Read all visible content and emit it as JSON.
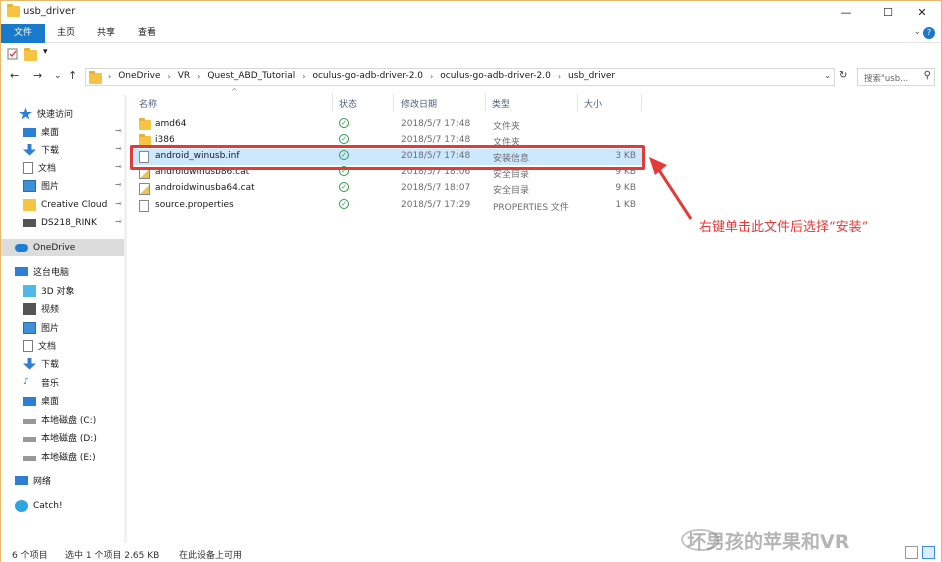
{
  "window": {
    "title": "usb_driver",
    "minimize": "—",
    "maximize": "☐",
    "close": "✕"
  },
  "ribbon": {
    "tabs": [
      "文件",
      "主页",
      "共享",
      "查看"
    ],
    "expand": "⌄",
    "help": "?"
  },
  "quick_access": {
    "dropdown": "▾"
  },
  "nav": {
    "back": "←",
    "forward": "→",
    "recent": "⌄",
    "up": "↑",
    "breadcrumbs": [
      "OneDrive",
      "VR",
      "Quest_ABD_Tutorial",
      "oculus-go-adb-driver-2.0",
      "oculus-go-adb-driver-2.0",
      "usb_driver"
    ],
    "dropdown": "⌄",
    "refresh": "↻",
    "search_placeholder": "搜索\"usb...",
    "search_icon": "⚲"
  },
  "sidebar": {
    "items": [
      {
        "label": "快速访问",
        "icon": "star-icon",
        "pinned": false
      },
      {
        "label": "桌面",
        "icon": "desktop-icon",
        "pinned": true
      },
      {
        "label": "下载",
        "icon": "download-icon",
        "pinned": true
      },
      {
        "label": "文档",
        "icon": "document-icon",
        "pinned": true
      },
      {
        "label": "图片",
        "icon": "picture-icon",
        "pinned": true
      },
      {
        "label": "Creative Cloud",
        "icon": "folder-icon",
        "pinned": true
      },
      {
        "label": "DS218_RINK",
        "icon": "network-drive-icon",
        "pinned": true
      },
      {
        "label": "OneDrive",
        "icon": "cloud-icon",
        "pinned": false
      },
      {
        "label": "这台电脑",
        "icon": "computer-icon",
        "pinned": false
      },
      {
        "label": "3D 对象",
        "icon": "cube-icon",
        "pinned": false
      },
      {
        "label": "视频",
        "icon": "video-icon",
        "pinned": false
      },
      {
        "label": "图片",
        "icon": "picture-icon",
        "pinned": false
      },
      {
        "label": "文档",
        "icon": "document-icon",
        "pinned": false
      },
      {
        "label": "下载",
        "icon": "download-icon",
        "pinned": false
      },
      {
        "label": "音乐",
        "icon": "music-icon",
        "pinned": false
      },
      {
        "label": "桌面",
        "icon": "desktop-icon",
        "pinned": false
      },
      {
        "label": "本地磁盘 (C:)",
        "icon": "drive-icon",
        "pinned": false
      },
      {
        "label": "本地磁盘 (D:)",
        "icon": "drive-icon",
        "pinned": false
      },
      {
        "label": "本地磁盘 (E:)",
        "icon": "drive-icon",
        "pinned": false
      },
      {
        "label": "网络",
        "icon": "network-icon",
        "pinned": false
      },
      {
        "label": "Catch!",
        "icon": "catch-icon",
        "pinned": false
      }
    ],
    "pin_glyph": "📌"
  },
  "columns": {
    "name": "名称",
    "status": "状态",
    "modified": "修改日期",
    "type": "类型",
    "size": "大小",
    "sort_glyph": "^"
  },
  "files": [
    {
      "name": "amd64",
      "date": "2018/5/7 17:48",
      "type": "文件夹",
      "size": "",
      "icon": "folder-icon",
      "selected": false
    },
    {
      "name": "i386",
      "date": "2018/5/7 17:48",
      "type": "文件夹",
      "size": "",
      "icon": "folder-icon",
      "selected": false
    },
    {
      "name": "android_winusb.inf",
      "date": "2018/5/7 17:48",
      "type": "安装信息",
      "size": "3 KB",
      "icon": "inf-file-icon",
      "selected": true
    },
    {
      "name": "androidwinusb86.cat",
      "date": "2018/5/7 18:06",
      "type": "安全目录",
      "size": "9 KB",
      "icon": "catalog-file-icon",
      "selected": false
    },
    {
      "name": "androidwinusba64.cat",
      "date": "2018/5/7 18:07",
      "type": "安全目录",
      "size": "9 KB",
      "icon": "catalog-file-icon",
      "selected": false
    },
    {
      "name": "source.properties",
      "date": "2018/5/7 17:29",
      "type": "PROPERTIES 文件",
      "size": "1 KB",
      "icon": "file-icon",
      "selected": false
    }
  ],
  "status_check": "✓",
  "annotation": "右键单击此文件后选择“安装”",
  "statusbar": {
    "count": "6 个项目",
    "selection": "选中 1 个项目  2.65 KB",
    "availability": "在此设备上可用"
  },
  "watermark": "坏男孩的苹果和VR",
  "colors": {
    "accent": "#1979ca",
    "selection": "#cce8ff",
    "annotation": "#e53a3a",
    "status_ok": "#2e9a4b"
  }
}
